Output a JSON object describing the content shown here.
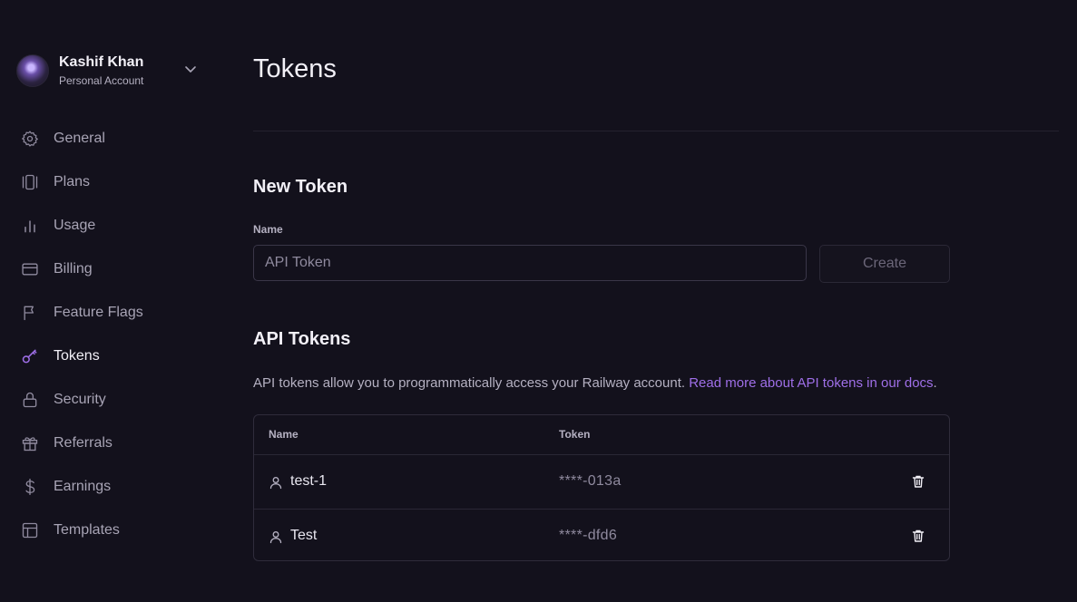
{
  "account": {
    "name": "Kashif Khan",
    "type": "Personal Account"
  },
  "sidebar": {
    "items": [
      {
        "label": "General",
        "icon": "gear-icon",
        "active": false
      },
      {
        "label": "Plans",
        "icon": "plans-icon",
        "active": false
      },
      {
        "label": "Usage",
        "icon": "bar-chart-icon",
        "active": false
      },
      {
        "label": "Billing",
        "icon": "credit-card-icon",
        "active": false
      },
      {
        "label": "Feature Flags",
        "icon": "flag-icon",
        "active": false
      },
      {
        "label": "Tokens",
        "icon": "key-icon",
        "active": true
      },
      {
        "label": "Security",
        "icon": "lock-icon",
        "active": false
      },
      {
        "label": "Referrals",
        "icon": "gift-icon",
        "active": false
      },
      {
        "label": "Earnings",
        "icon": "dollar-icon",
        "active": false
      },
      {
        "label": "Templates",
        "icon": "template-icon",
        "active": false
      }
    ]
  },
  "page": {
    "title": "Tokens"
  },
  "new_token": {
    "title": "New Token",
    "name_label": "Name",
    "name_placeholder": "API Token",
    "create_label": "Create"
  },
  "api_tokens": {
    "title": "API Tokens",
    "description": "API tokens allow you to programmatically access your Railway account. ",
    "docs_link": "Read more about API tokens in our docs",
    "description_end": ".",
    "columns": {
      "name": "Name",
      "token": "Token"
    },
    "rows": [
      {
        "name": "test-1",
        "token": "****-013a"
      },
      {
        "name": "Test",
        "token": "****-dfd6"
      }
    ]
  },
  "colors": {
    "background": "#13111c",
    "accent": "#9f6fe8",
    "text": "#e9e7f0",
    "muted": "#a8a4b5"
  }
}
